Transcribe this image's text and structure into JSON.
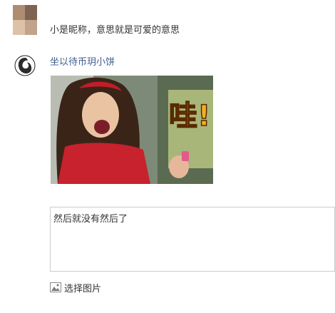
{
  "previous_comment": {
    "text": "小是昵称，意思就是可爱的意思"
  },
  "reply": {
    "username": "坐以待币玥小饼",
    "image_overlay_text": "哇!",
    "input_value": "然后就没有然后了",
    "choose_image_label": "选择图片"
  },
  "icons": {
    "image_picker": "image-icon"
  }
}
